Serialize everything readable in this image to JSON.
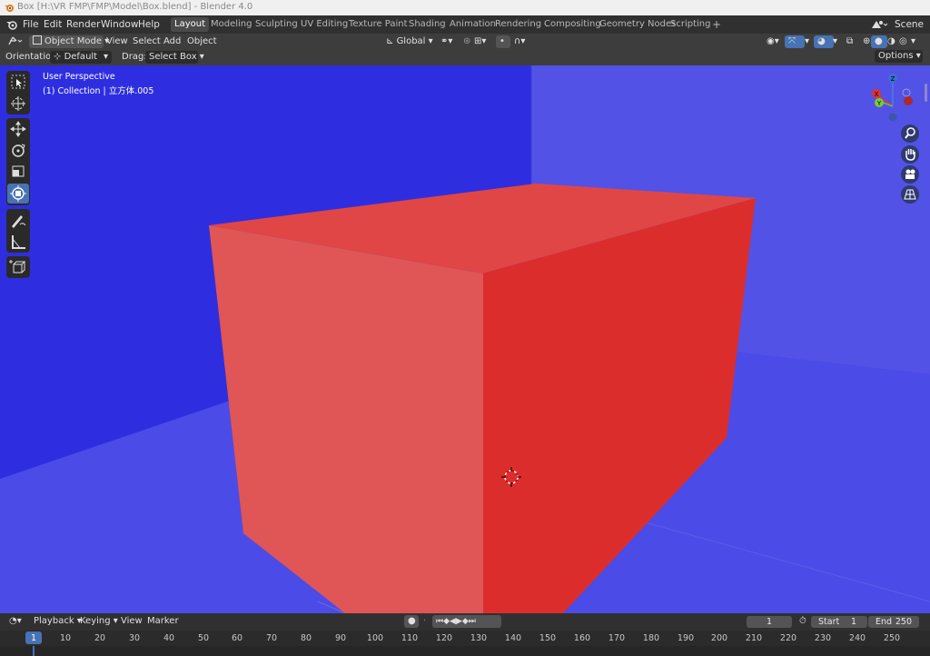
{
  "window": {
    "title": "Box [H:\\VR FMP\\FMP\\Model\\Box.blend] - Blender 4.0"
  },
  "menubar": {
    "menus": [
      "File",
      "Edit",
      "Render",
      "Window",
      "Help"
    ],
    "workspaces": [
      "Layout",
      "Modeling",
      "Sculpting",
      "UV Editing",
      "Texture Paint",
      "Shading",
      "Animation",
      "Rendering",
      "Compositing",
      "Geometry Nodes",
      "Scripting"
    ],
    "active_workspace": "Layout",
    "add_tab": "+",
    "scene": "Scene"
  },
  "viewport_header": {
    "mode": "Object Mode",
    "menus": [
      "View",
      "Select",
      "Add",
      "Object"
    ],
    "transform_orientation": "Global"
  },
  "tool_settings": {
    "orientation_label": "Orientation:",
    "orientation_value": "Default",
    "drag_label": "Drag:",
    "drag_value": "Select Box",
    "options": "Options"
  },
  "viewport": {
    "view_name": "User Perspective",
    "collection_info": "(1) Collection | 立方体.005",
    "gizmo_axes": [
      "Z",
      "X",
      "Y"
    ],
    "colors": {
      "background": "#2e2ee0",
      "floor": "#4b4be8",
      "cube_top": "#e04646",
      "cube_left": "#e05555",
      "cube_right": "#dc2d2d"
    }
  },
  "timeline": {
    "menus": [
      "Playback",
      "Keying",
      "View",
      "Marker"
    ],
    "current_frame": "1",
    "start_label": "Start",
    "start_value": "1",
    "end_label": "End",
    "end_value": "250",
    "ruler_ticks": [
      "1",
      "10",
      "20",
      "30",
      "40",
      "50",
      "60",
      "70",
      "80",
      "90",
      "100",
      "110",
      "120",
      "130",
      "140",
      "150",
      "160",
      "170",
      "180",
      "190",
      "200",
      "210",
      "220",
      "230",
      "240",
      "250"
    ]
  }
}
